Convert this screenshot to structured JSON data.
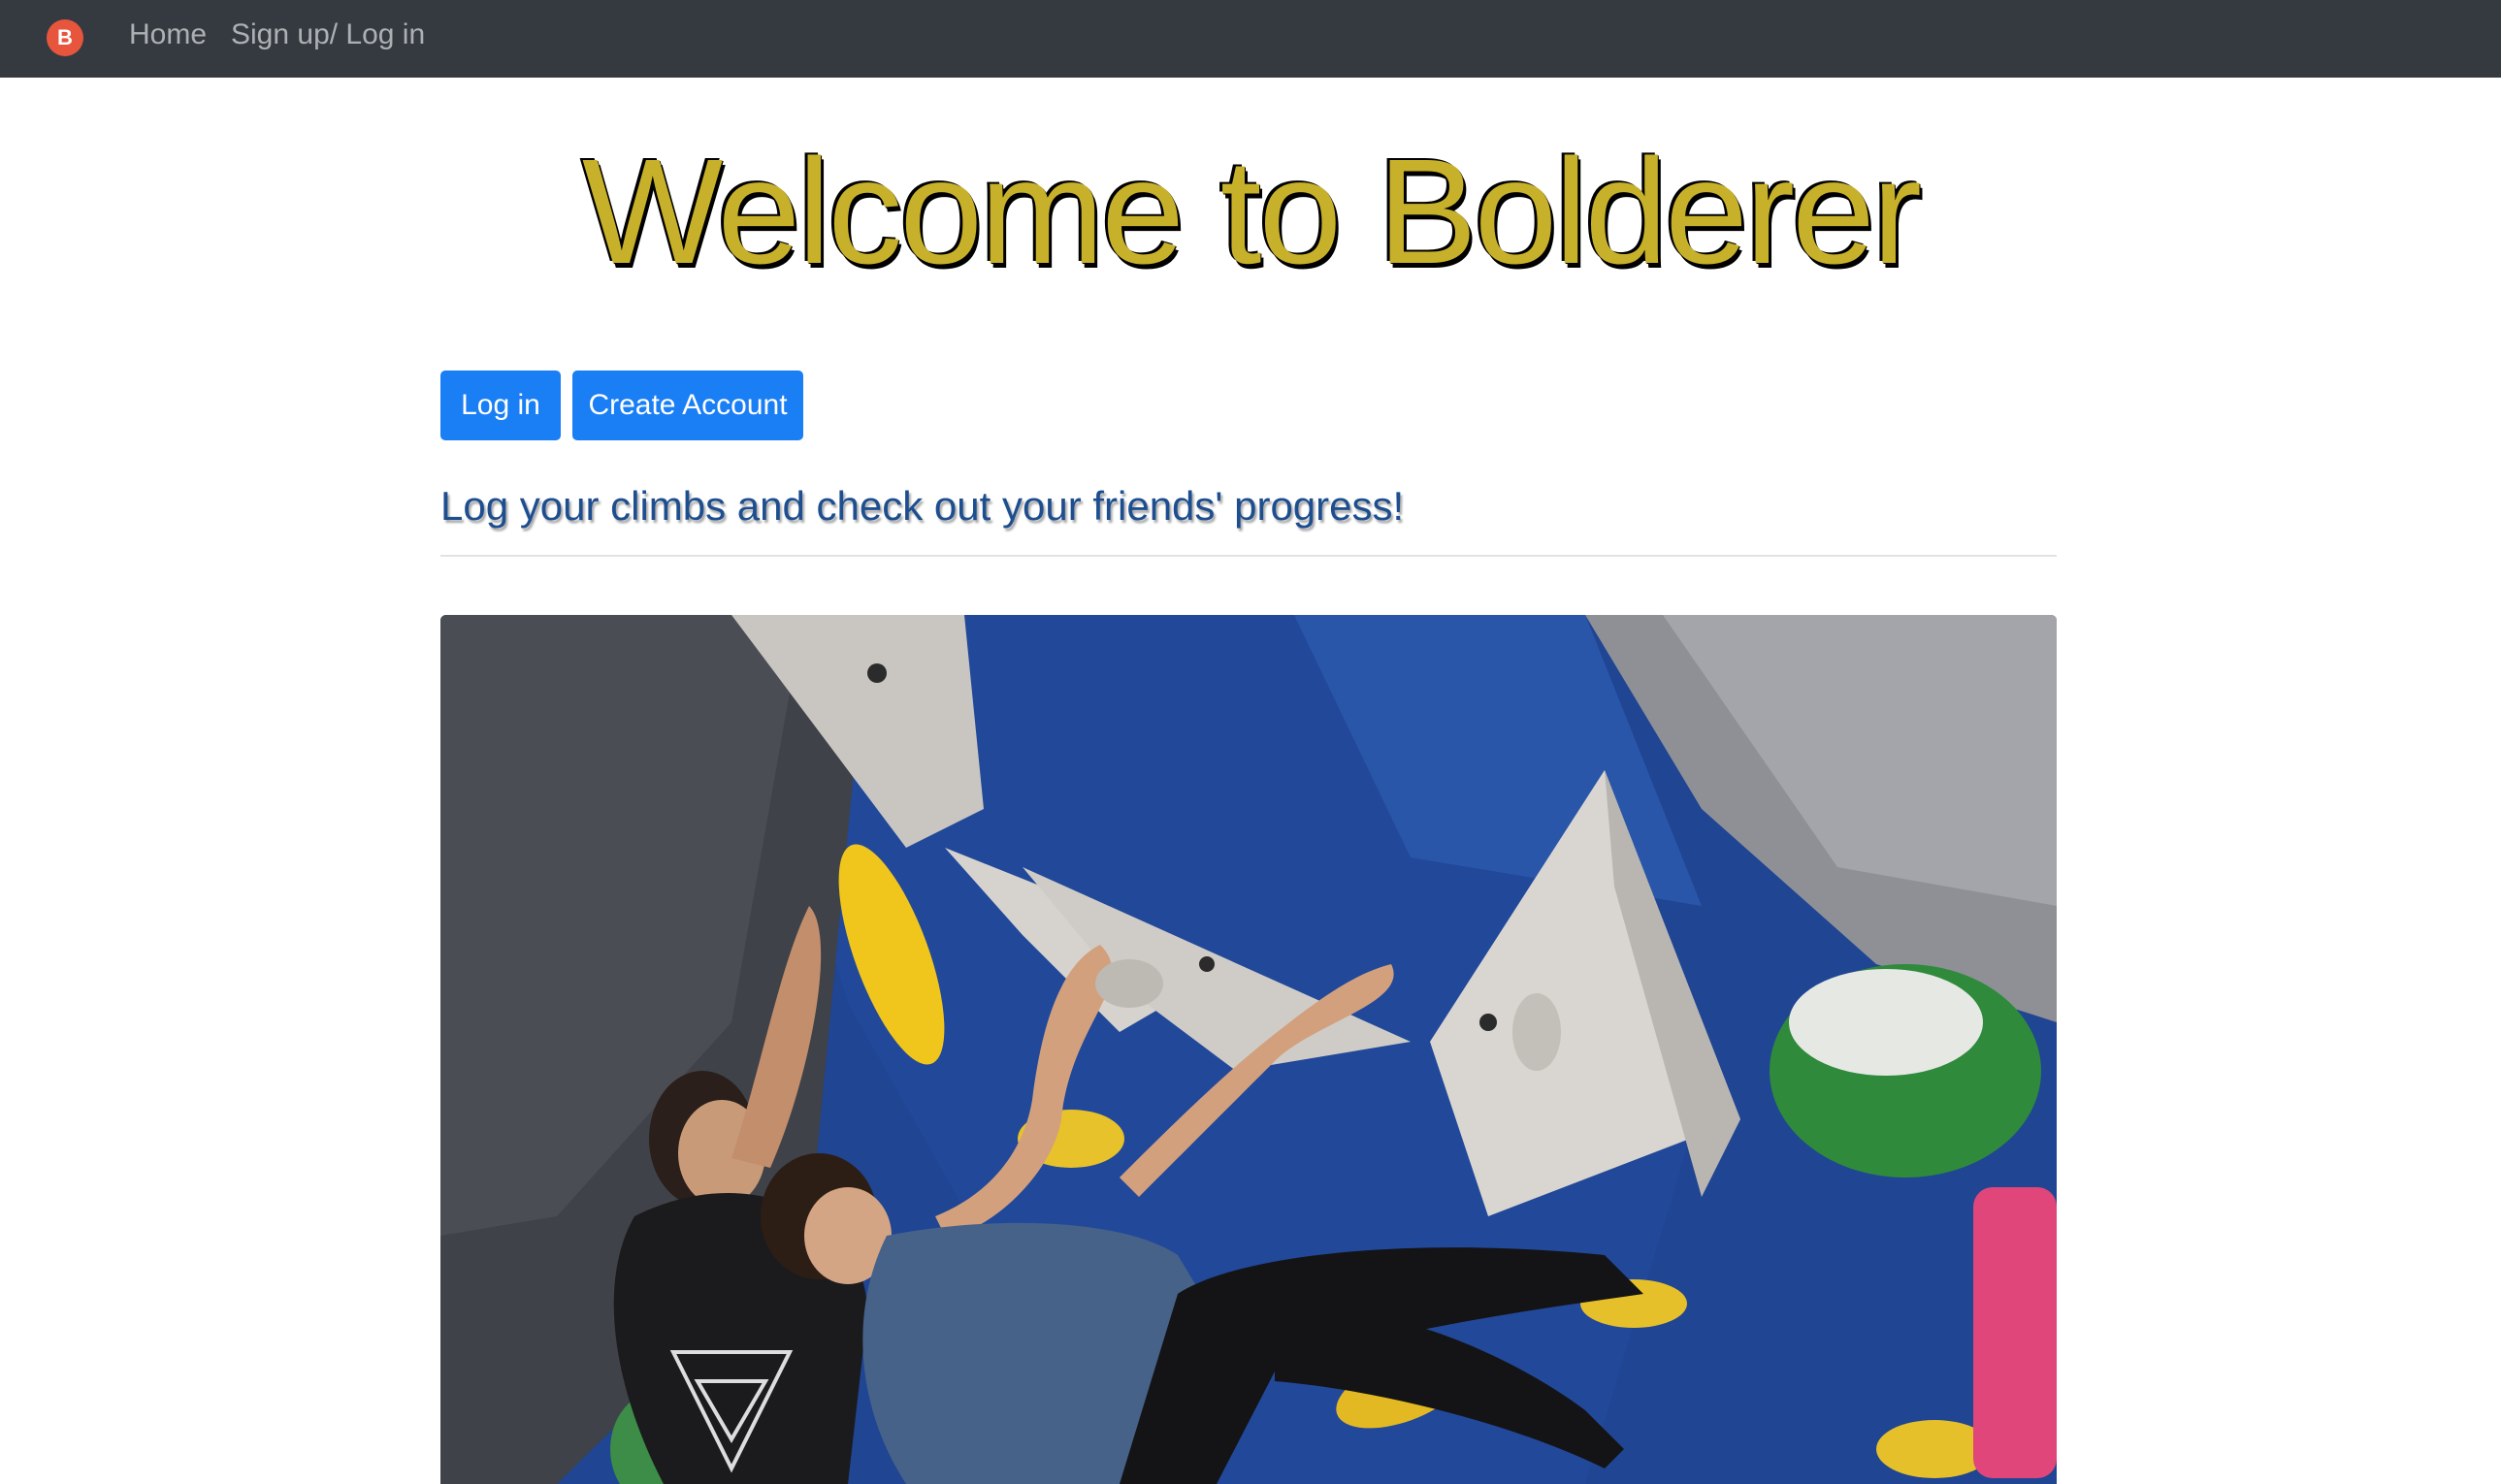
{
  "navbar": {
    "brand_letter": "B",
    "links": [
      {
        "label": "Home"
      },
      {
        "label": "Sign up/ Log in"
      }
    ]
  },
  "hero": {
    "title": "Welcome to Bolderer"
  },
  "actions": {
    "login_label": "Log in",
    "create_label": "Create Account"
  },
  "tagline": "Log your climbs and check out your friends' progress!",
  "colors": {
    "navbar_bg": "#343a40",
    "title_gold": "#c8b12a",
    "button_blue": "#1a7ef5",
    "tagline_blue": "#1d4e8f",
    "brand_red": "#e8553d"
  },
  "image": {
    "icon": "climbing-photo"
  }
}
